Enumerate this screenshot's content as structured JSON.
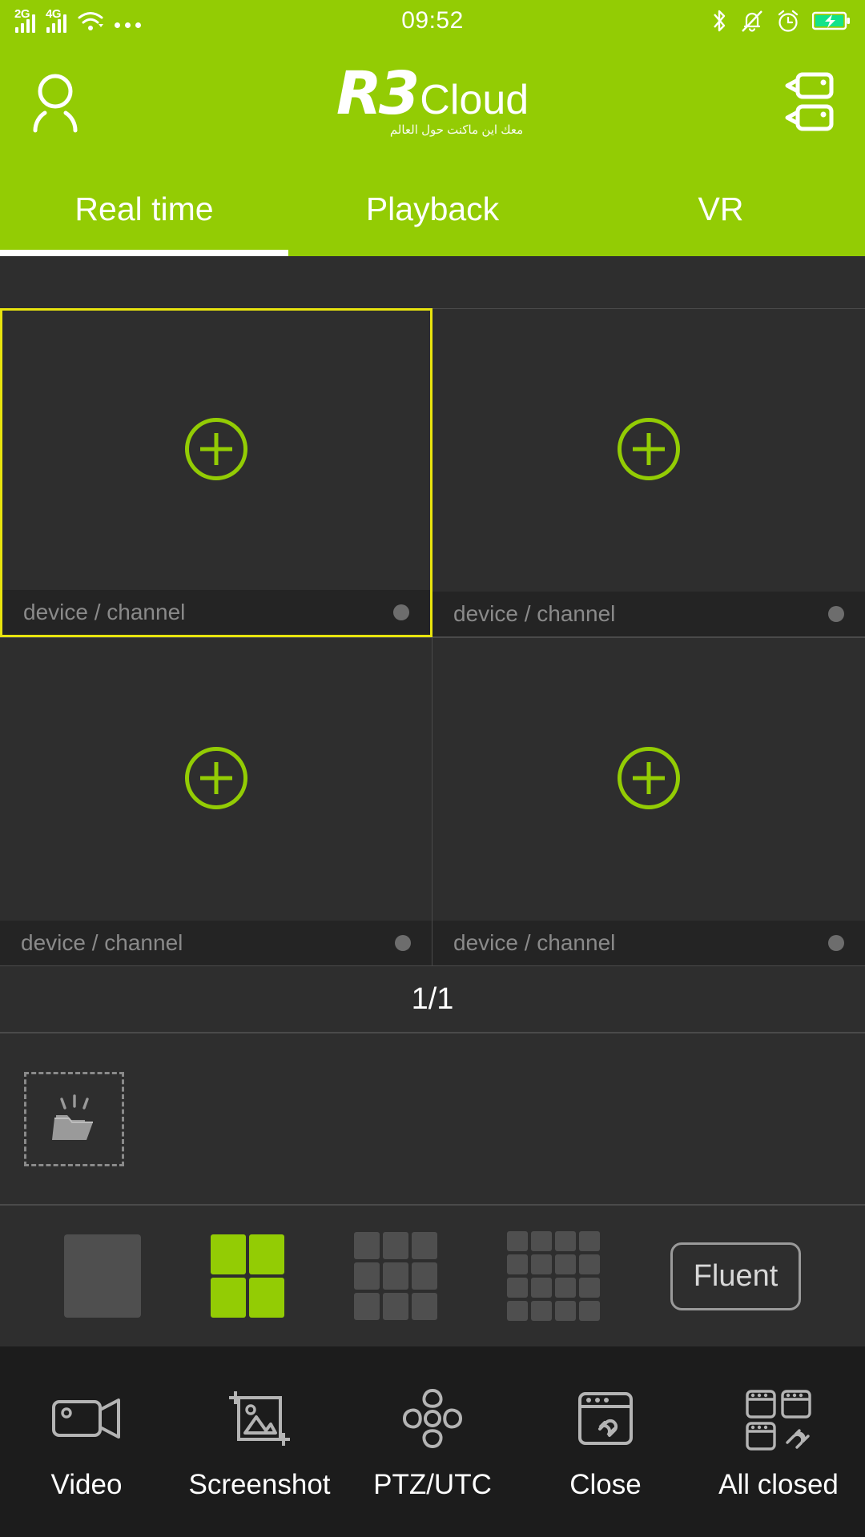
{
  "statusbar": {
    "time": "09:52",
    "left_icons": [
      {
        "name": "signal-2g-icon",
        "label": "2G"
      },
      {
        "name": "signal-4g-icon",
        "label": "4G"
      },
      {
        "name": "wifi-icon",
        "label": ""
      },
      {
        "name": "overflow-dots-icon",
        "label": ""
      }
    ],
    "right_icons": [
      {
        "name": "bluetooth-icon"
      },
      {
        "name": "bell-muted-icon"
      },
      {
        "name": "alarm-clock-icon"
      },
      {
        "name": "battery-charging-icon"
      }
    ],
    "battery_color": "#12e38a"
  },
  "header": {
    "brand_mark": "R3",
    "brand_word": "Cloud",
    "brand_tagline": "معك اين ماكنت حول العالم",
    "profile_icon": "person-icon",
    "devices_icon": "dual-camera-icon",
    "background": "#93cc04"
  },
  "tabs": {
    "items": [
      {
        "label": "Real time",
        "active": true
      },
      {
        "label": "Playback",
        "active": false
      },
      {
        "label": "VR",
        "active": false
      }
    ]
  },
  "video_grid": {
    "selection_color": "#e8e40e",
    "add_color": "#93cc04",
    "cells": [
      {
        "label": "device / channel",
        "selected": true,
        "add_icon": "plus-circle-icon",
        "status_dot": "offline"
      },
      {
        "label": "device / channel",
        "selected": false,
        "add_icon": "plus-circle-icon",
        "status_dot": "offline"
      },
      {
        "label": "device / channel",
        "selected": false,
        "add_icon": "plus-circle-icon",
        "status_dot": "offline"
      },
      {
        "label": "device / channel",
        "selected": false,
        "add_icon": "plus-circle-icon",
        "status_dot": "offline"
      }
    ]
  },
  "page_indicator": {
    "text": "1/1"
  },
  "file_strip": {
    "placeholder_icon": "open-folder-icon"
  },
  "layout_bar": {
    "options": [
      {
        "name": "layout-1x1",
        "grid": "1x1",
        "selected": false
      },
      {
        "name": "layout-2x2",
        "grid": "2x2",
        "selected": true
      },
      {
        "name": "layout-3x3",
        "grid": "3x3",
        "selected": false
      },
      {
        "name": "layout-4x4",
        "grid": "4x4",
        "selected": false
      }
    ],
    "quality_label": "Fluent",
    "selected_color": "#93cc04",
    "unselected_color": "#4f4f4f"
  },
  "bottom_nav": {
    "items": [
      {
        "label": "Video",
        "icon": "camcorder-icon"
      },
      {
        "label": "Screenshot",
        "icon": "image-crop-icon"
      },
      {
        "label": "PTZ/UTC",
        "icon": "dpad-icon"
      },
      {
        "label": "Close",
        "icon": "window-link-icon"
      },
      {
        "label": "All closed",
        "icon": "multi-window-link-icon"
      }
    ]
  }
}
